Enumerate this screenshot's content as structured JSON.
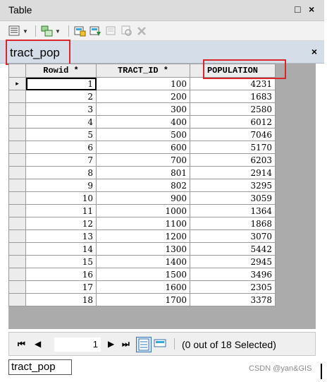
{
  "window": {
    "title": "Table",
    "restore_label": "□",
    "close_label": "×"
  },
  "toolbar": {
    "buttons": [
      "table-options-icon",
      "related-tables-icon",
      "select-by-attributes-icon",
      "switch-selection-icon",
      "clear-selection-icon",
      "zoom-to-selected-icon",
      "delete-selected-icon"
    ]
  },
  "tab": {
    "name": "tract_pop",
    "close_label": "×"
  },
  "table": {
    "columns": [
      "Rowid *",
      "TRACT_ID *",
      "POPULATION"
    ],
    "rows": [
      [
        "1",
        "100",
        "4231"
      ],
      [
        "2",
        "200",
        "1683"
      ],
      [
        "3",
        "300",
        "2580"
      ],
      [
        "4",
        "400",
        "6012"
      ],
      [
        "5",
        "500",
        "7046"
      ],
      [
        "6",
        "600",
        "5170"
      ],
      [
        "7",
        "700",
        "6203"
      ],
      [
        "8",
        "801",
        "2914"
      ],
      [
        "9",
        "802",
        "3295"
      ],
      [
        "10",
        "900",
        "3059"
      ],
      [
        "11",
        "1000",
        "1364"
      ],
      [
        "12",
        "1100",
        "1868"
      ],
      [
        "13",
        "1200",
        "3070"
      ],
      [
        "14",
        "1300",
        "5442"
      ],
      [
        "15",
        "1400",
        "2945"
      ],
      [
        "16",
        "1500",
        "3496"
      ],
      [
        "17",
        "1600",
        "2305"
      ],
      [
        "18",
        "1700",
        "3378"
      ]
    ],
    "current_row_marker": "▸"
  },
  "nav": {
    "first_label": "⏮",
    "prev_label": "◀",
    "record": "1",
    "next_label": "▶",
    "last_label": "⏭",
    "status": "(0 out of 18 Selected)"
  },
  "bottom_tab": {
    "label": "tract_pop"
  },
  "watermark": "CSDN @yan&GIS",
  "colors": {
    "highlight_box": "#d9262c",
    "tabbar": "#d4dde8",
    "grid_bg": "#ababab"
  }
}
